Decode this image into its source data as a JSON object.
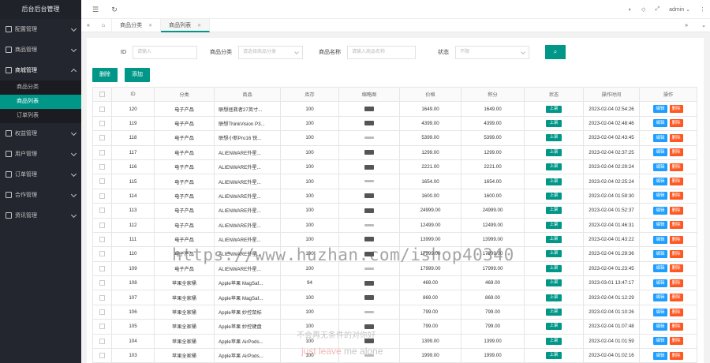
{
  "sidebar": {
    "title": "后台后台管理",
    "items": [
      {
        "label": "配置管理",
        "open": false
      },
      {
        "label": "商品管理",
        "open": false
      },
      {
        "label": "商城管理",
        "open": true,
        "children": [
          {
            "label": "商品分类",
            "active": false
          },
          {
            "label": "商品列表",
            "active": true
          },
          {
            "label": "订单列表",
            "active": false
          }
        ]
      },
      {
        "label": "权益管理",
        "open": false
      },
      {
        "label": "用户管理",
        "open": false
      },
      {
        "label": "订单管理",
        "open": false
      },
      {
        "label": "合作管理",
        "open": false
      },
      {
        "label": "资讯管理",
        "open": false
      }
    ]
  },
  "topbar": {
    "user": "admin"
  },
  "tabs": [
    {
      "label": "商品分类",
      "active": false
    },
    {
      "label": "商品列表",
      "active": true
    }
  ],
  "filter": {
    "id_label": "ID",
    "id_placeholder": "请输入",
    "category_label": "商品分类",
    "category_placeholder": "请选择商品分类",
    "name_label": "商品名称",
    "name_placeholder": "请输入商品名称",
    "status_label": "状态",
    "status_placeholder": "不限"
  },
  "actions": {
    "delete": "删除",
    "add": "添加"
  },
  "table": {
    "headers": [
      "ID",
      "分类",
      "商品",
      "库存",
      "缩略图",
      "价格",
      "积分",
      "状态",
      "操作时间",
      "操作"
    ],
    "status_label": "上架",
    "edit_label": "编辑",
    "delete_label": "删除",
    "rows": [
      {
        "id": "120",
        "cat": "电子产品",
        "name": "联想拯救者27英寸...",
        "stock": "100",
        "price": "1649.00",
        "points": "1649.00",
        "time": "2023-02-04 02:54:26"
      },
      {
        "id": "119",
        "cat": "电子产品",
        "name": "联想ThinkVision P3...",
        "stock": "100",
        "price": "4399.00",
        "points": "4399.00",
        "time": "2023-02-04 02:48:46"
      },
      {
        "id": "118",
        "cat": "电子产品",
        "name": "联想小新Pro16 锐...",
        "stock": "100",
        "price": "5399.00",
        "points": "5399.00",
        "time": "2023-02-04 02:43:45"
      },
      {
        "id": "117",
        "cat": "电子产品",
        "name": "ALIENWARE外星...",
        "stock": "100",
        "price": "1299.00",
        "points": "1299.00",
        "time": "2023-02-04 02:37:25"
      },
      {
        "id": "116",
        "cat": "电子产品",
        "name": "ALIENWARE外星...",
        "stock": "100",
        "price": "2221.00",
        "points": "2221.00",
        "time": "2023-02-04 02:29:24"
      },
      {
        "id": "115",
        "cat": "电子产品",
        "name": "ALIENWARE外星...",
        "stock": "100",
        "price": "1654.00",
        "points": "1654.00",
        "time": "2023-02-04 02:25:24"
      },
      {
        "id": "114",
        "cat": "电子产品",
        "name": "ALIENWARE外星...",
        "stock": "100",
        "price": "1600.00",
        "points": "1600.00",
        "time": "2023-02-04 01:59:30"
      },
      {
        "id": "113",
        "cat": "电子产品",
        "name": "ALIENWARE外星...",
        "stock": "100",
        "price": "24999.00",
        "points": "24999.00",
        "time": "2023-02-04 01:52:37"
      },
      {
        "id": "112",
        "cat": "电子产品",
        "name": "ALIENWARE外星...",
        "stock": "100",
        "price": "12499.00",
        "points": "12499.00",
        "time": "2023-02-04 01:46:31"
      },
      {
        "id": "111",
        "cat": "电子产品",
        "name": "ALIENWARE外星...",
        "stock": "100",
        "price": "13999.00",
        "points": "13999.00",
        "time": "2023-02-04 01:43:22"
      },
      {
        "id": "110",
        "cat": "电子产品",
        "name": "ALIENWARE外星...",
        "stock": "100",
        "price": "17999.00",
        "points": "17999.00",
        "time": "2023-02-04 01:29:36"
      },
      {
        "id": "109",
        "cat": "电子产品",
        "name": "ALIENWARE外星...",
        "stock": "100",
        "price": "17999.00",
        "points": "17999.00",
        "time": "2023-02-04 01:23:45"
      },
      {
        "id": "108",
        "cat": "苹果全家桶",
        "name": "Apple苹果 MagSaf...",
        "stock": "94",
        "price": "469.00",
        "points": "469.00",
        "time": "2023-03-01 13:47:17"
      },
      {
        "id": "107",
        "cat": "苹果全家桶",
        "name": "Apple苹果 MagSaf...",
        "stock": "100",
        "price": "869.00",
        "points": "869.00",
        "time": "2023-02-04 01:12:29"
      },
      {
        "id": "106",
        "cat": "苹果全家桶",
        "name": "Apple苹果 妙控鼠标",
        "stock": "100",
        "price": "799.00",
        "points": "799.00",
        "time": "2023-02-04 01:10:26"
      },
      {
        "id": "105",
        "cat": "苹果全家桶",
        "name": "Apple苹果 妙控键盘",
        "stock": "100",
        "price": "799.00",
        "points": "799.00",
        "time": "2023-02-04 01:07:48"
      },
      {
        "id": "104",
        "cat": "苹果全家桶",
        "name": "Apple苹果 AirPods...",
        "stock": "100",
        "price": "1399.00",
        "points": "1399.00",
        "time": "2023-02-04 01:01:59"
      },
      {
        "id": "103",
        "cat": "苹果全家桶",
        "name": "Apple苹果 AirPods...",
        "stock": "100",
        "price": "1999.00",
        "points": "1999.00",
        "time": "2023-02-04 01:02:16"
      }
    ]
  },
  "watermark": {
    "url": "https://www.huzhan.com/ishop40340",
    "line2": "不会再无条件的对你好",
    "line3a": "just leave",
    "line3b": " me alone"
  }
}
